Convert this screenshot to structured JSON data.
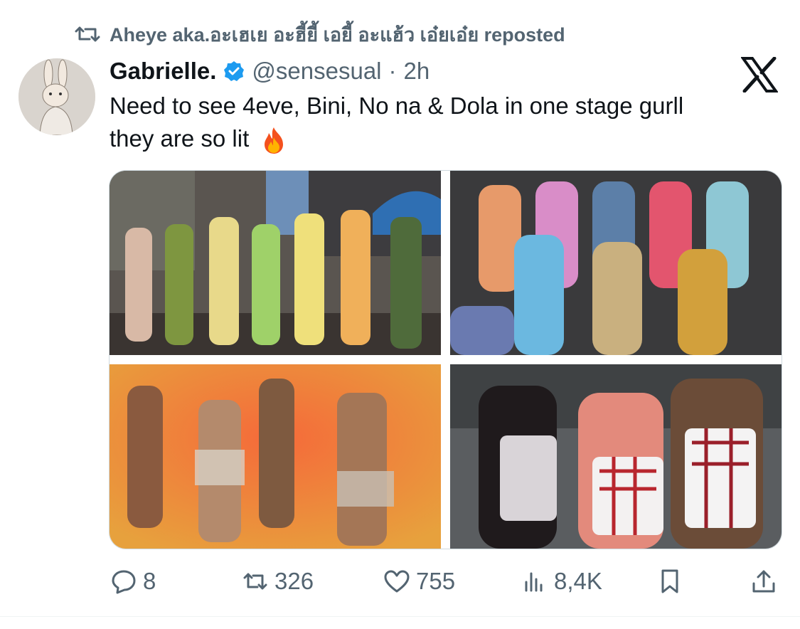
{
  "repost": {
    "icon": "retweet-icon",
    "text": "Aheye aka.อะเฮเย อะฮี้ยี้ เอยี้ อะแฮ้ว เอ๋ยเอ๋ย reposted"
  },
  "tweet": {
    "author_name": "Gabrielle.",
    "verified": true,
    "handle": "@sensesual",
    "separator": "·",
    "time": "2h",
    "text": "Need to see 4eve, Bini, No na & Dola in one stage gurll\nthey are so lit",
    "emoji_icon": "fire-emoji-icon"
  },
  "brand": {
    "logo": "x-logo-icon"
  },
  "media": [
    {
      "name": "photo-1",
      "desc_icon": "group-photo"
    },
    {
      "name": "photo-2",
      "desc_icon": "group-photo"
    },
    {
      "name": "photo-3",
      "desc_icon": "group-photo"
    },
    {
      "name": "photo-4",
      "desc_icon": "group-photo"
    }
  ],
  "actions": {
    "replies": "8",
    "retweets": "326",
    "likes": "755",
    "views": "8,4K"
  },
  "colors": {
    "text_primary": "#0f1419",
    "text_secondary": "#536471",
    "verified_blue": "#1d9bf0",
    "border": "#cfd9de"
  }
}
